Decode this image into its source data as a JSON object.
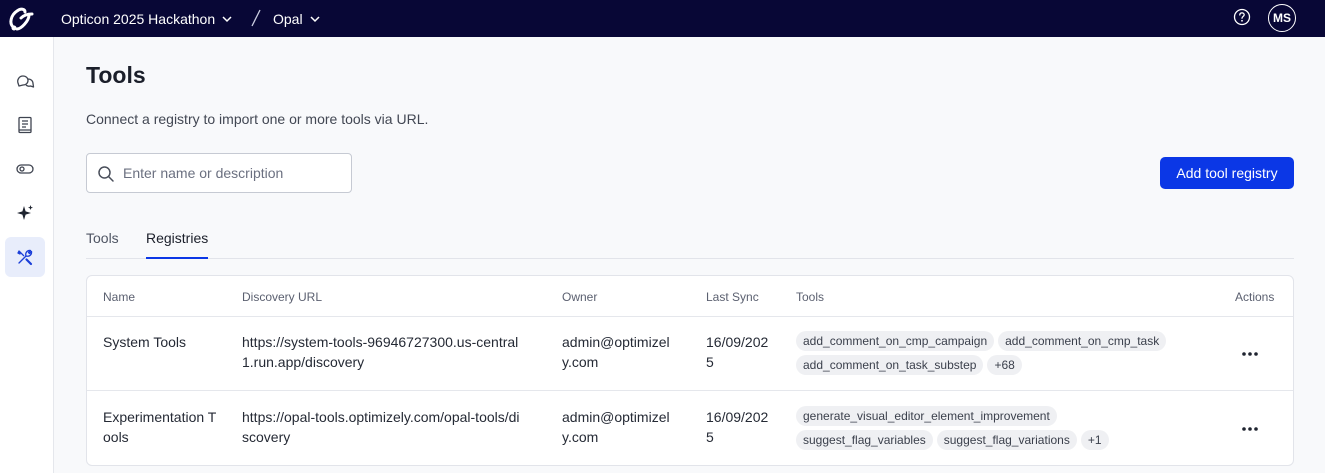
{
  "topbar": {
    "org_name": "Opticon 2025 Hackathon",
    "separator": "/",
    "product_name": "Opal",
    "avatar_initials": "MS",
    "background": "#080736"
  },
  "sidebar": {
    "items": [
      {
        "icon": "chat-icon",
        "active": false
      },
      {
        "icon": "book-icon",
        "active": false
      },
      {
        "icon": "toggle-icon",
        "active": false
      },
      {
        "icon": "sparkle-icon",
        "active": false
      },
      {
        "icon": "tools-icon",
        "active": true
      }
    ]
  },
  "page": {
    "title": "Tools",
    "description": "Connect a registry to import one or more tools via URL."
  },
  "search": {
    "placeholder": "Enter name or description",
    "value": ""
  },
  "add_button_label": "Add tool registry",
  "accent_color": "#0b37e6",
  "tabs": [
    {
      "label": "Tools",
      "active": false
    },
    {
      "label": "Registries",
      "active": true
    }
  ],
  "table": {
    "headers": {
      "name": "Name",
      "url": "Discovery URL",
      "owner": "Owner",
      "sync": "Last Sync",
      "tools": "Tools",
      "actions": "Actions"
    },
    "rows": [
      {
        "name": "System Tools",
        "url": "https://system-tools-96946727300.us-central1.run.app/discovery",
        "owner": "admin@optimizely.com",
        "sync": "16/09/2025",
        "tools": [
          "add_comment_on_cmp_campaign",
          "add_comment_on_cmp_task",
          "add_comment_on_task_substep",
          "+68"
        ]
      },
      {
        "name": "Experimentation Tools",
        "url": "https://opal-tools.optimizely.com/opal-tools/discovery",
        "owner": "admin@optimizely.com",
        "sync": "16/09/2025",
        "tools": [
          "generate_visual_editor_element_improvement",
          "suggest_flag_variables",
          "suggest_flag_variations",
          "+1"
        ]
      }
    ]
  }
}
